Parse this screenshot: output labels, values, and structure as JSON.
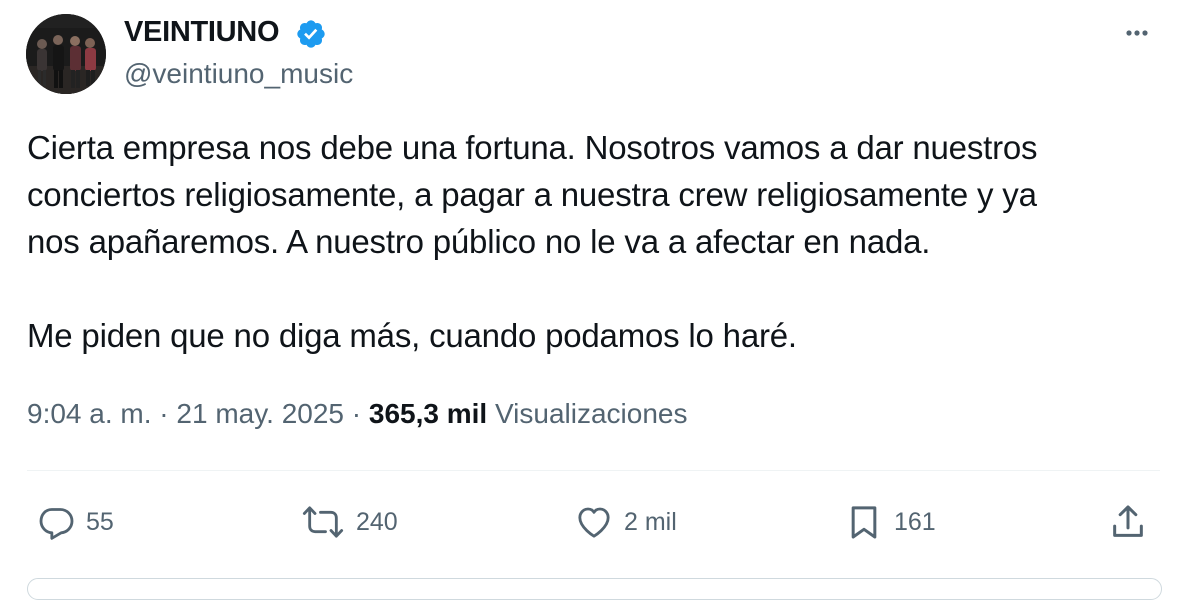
{
  "author": {
    "display_name": "VEINTIUNO",
    "handle": "@veintiuno_music"
  },
  "tweet": {
    "paragraphs": [
      "Cierta empresa nos debe una fortuna. Nosotros vamos a dar nuestros",
      "conciertos religiosamente, a pagar a nuestra crew religiosamente y ya",
      "nos apañaremos. A nuestro público no le va a afectar en nada.",
      "Me piden que no diga más, cuando podamos lo haré."
    ]
  },
  "meta": {
    "time": "9:04 a. m.",
    "separator": " · ",
    "date": "21 may. 2025",
    "views_count": "365,3 mil",
    "views_label": "Visualizaciones"
  },
  "actions": {
    "replies": "55",
    "reposts": "240",
    "likes": "2 mil",
    "bookmarks": "161"
  },
  "icons": {
    "verified": "verified-badge-icon",
    "more": "more-options-icon",
    "reply": "reply-icon",
    "repost": "repost-icon",
    "like": "heart-icon",
    "bookmark": "bookmark-icon",
    "share": "share-icon"
  },
  "colors": {
    "text": "#0f1419",
    "secondary": "#536471",
    "verified": "#1d9bf0",
    "divider": "#eff3f4"
  }
}
